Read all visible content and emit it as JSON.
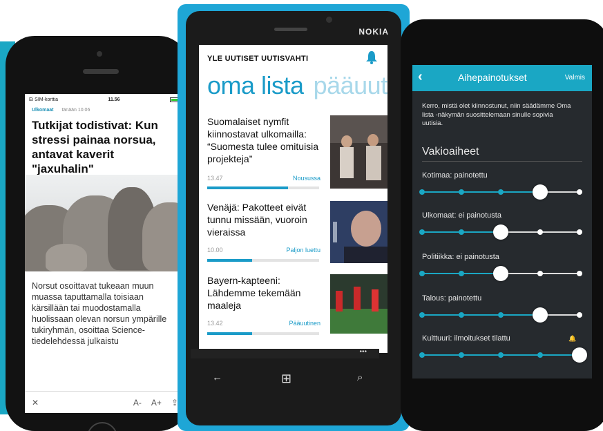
{
  "iphone": {
    "status": {
      "carrier": "Ei SIM-korttia",
      "time": "11.56"
    },
    "article": {
      "category": "Ulkomaat",
      "date": "tänään 10.06",
      "title": "Tutkijat todistivat: Kun stressi painaa norsua, antavat kaverit \"jaxuhalin\"",
      "body": "Norsut osoittavat tukeaan muun muassa taputtamalla toisiaan kärsillään tai muodostamalla huolissaan olevan norsun ympärille tukiryhmän, osoittaa Science-tiedelehdessä julkaistu"
    },
    "toolbar": {
      "close": "✕",
      "smaller": "A-",
      "larger": "A+",
      "share": "⇪"
    }
  },
  "nokia": {
    "brand": "NOKIA",
    "app_header": "YLE UUTISET UUTISVAHTI",
    "pivot": {
      "active": "oma lista",
      "next": "pääuut"
    },
    "news": [
      {
        "headline": "Suomalaiset nymfit kiinnostavat ulkomailla: “Suomesta tulee omituisia projekteja”",
        "time": "13.47",
        "tag": "Nousussa",
        "progress": 0.72
      },
      {
        "headline": "Venäjä: Pakotteet eivät tunnu missään, vuoroin vieraissa",
        "time": "10.00",
        "tag": "Paljon luettu",
        "progress": 0.4
      },
      {
        "headline": "Bayern-kapteeni: Lähdemme tekemään maaleja",
        "time": "13.42",
        "tag": "Pääuutinen",
        "progress": 0.4
      }
    ],
    "appbar_more": "•••",
    "nav": {
      "back": "←",
      "windows": "⊞",
      "search": "⌕"
    }
  },
  "android": {
    "toolbar": {
      "back": "‹",
      "title": "Aihepainotukset",
      "done": "Valmis"
    },
    "intro": "Kerro, mistä olet kiinnostunut, niin säädämme Oma lista -näkymän suosittelemaan sinulle sopivia uutisia.",
    "section_heading": "Vakioaiheet",
    "prefs": [
      {
        "label": "Kotimaa: painotettu",
        "level": 0.75,
        "bell": false
      },
      {
        "label": "Ulkomaat: ei painotusta",
        "level": 0.5,
        "bell": false
      },
      {
        "label": "Politiikka: ei painotusta",
        "level": 0.5,
        "bell": false
      },
      {
        "label": "Talous: painotettu",
        "level": 0.75,
        "bell": false
      },
      {
        "label": "Kulttuuri: ilmoitukset tilattu",
        "level": 1.0,
        "bell": true
      }
    ],
    "accent": "#1aa7c4"
  }
}
